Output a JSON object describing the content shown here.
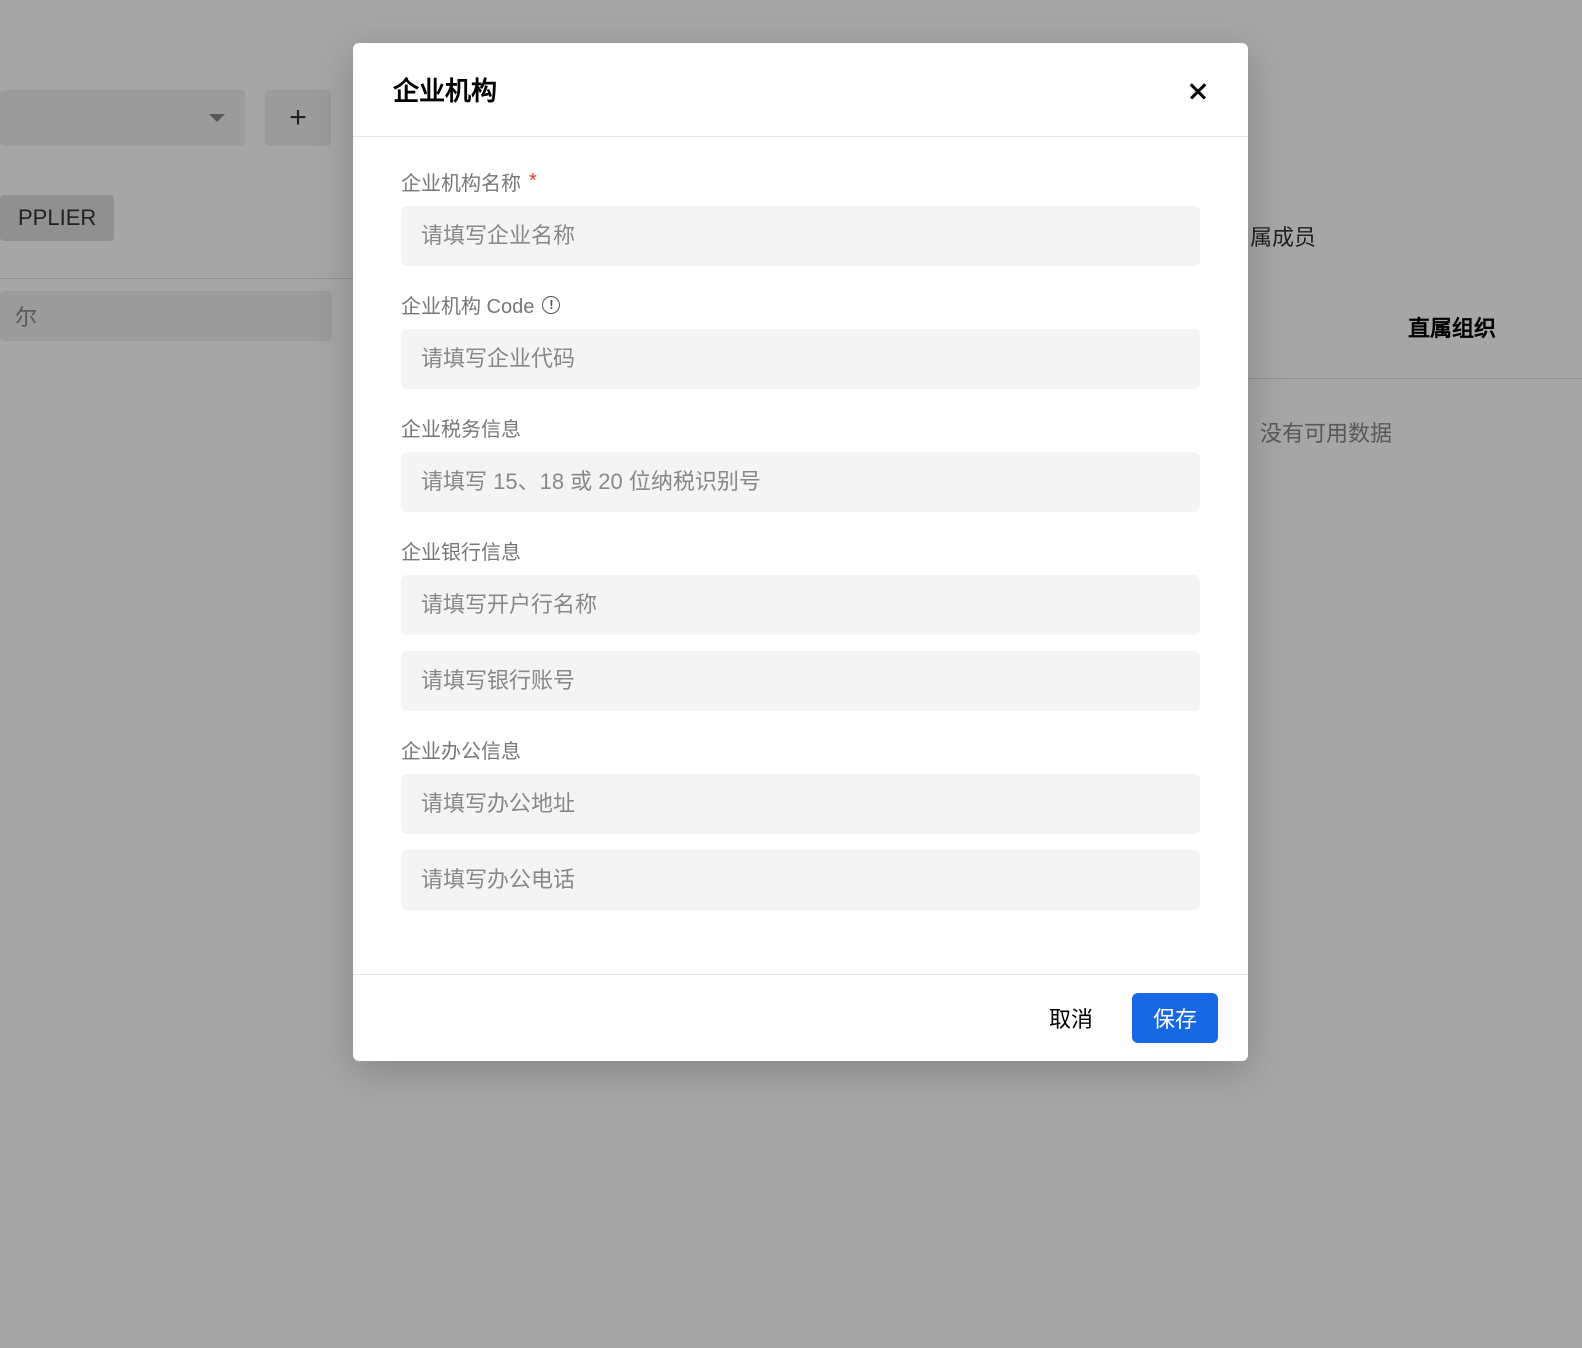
{
  "modal": {
    "title": "企业机构",
    "fields": {
      "org_name": {
        "label": "企业机构名称",
        "placeholder": "请填写企业名称",
        "required": true
      },
      "org_code": {
        "label": "企业机构 Code",
        "info": true,
        "placeholder": "请填写企业代码"
      },
      "tax_info": {
        "label": "企业税务信息",
        "placeholder": "请填写 15、18 或 20 位纳税识别号"
      },
      "bank_info": {
        "label": "企业银行信息",
        "bank_name_placeholder": "请填写开户行名称",
        "bank_account_placeholder": "请填写银行账号"
      },
      "office_info": {
        "label": "企业办公信息",
        "address_placeholder": "请填写办公地址",
        "phone_placeholder": "请填写办公电话"
      }
    },
    "buttons": {
      "cancel": "取消",
      "save": "保存"
    }
  },
  "background": {
    "chip": "PPLIER",
    "search": "尔",
    "right_header": "属成员",
    "tab": "直属组织",
    "no_data": "没有可用数据"
  }
}
